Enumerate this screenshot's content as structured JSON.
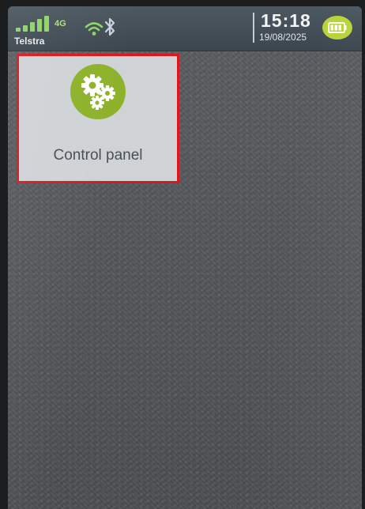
{
  "status_bar": {
    "network_type": "4G",
    "carrier": "Telstra",
    "signal_level": 5,
    "time": "15:18",
    "date": "19/08/2025",
    "battery_level": 1.0,
    "icons": {
      "signal": "cell-signal-icon",
      "wifi": "wifi-icon",
      "bluetooth": "bluetooth-icon",
      "battery": "battery-icon"
    }
  },
  "apps": [
    {
      "label": "Control panel",
      "icon": "gears-icon",
      "icon_color": "#8db22a",
      "selected": true
    }
  ],
  "colors": {
    "selection_border": "#e0161d",
    "signal": "#8fd36a",
    "battery_badge": "#b9d43a"
  }
}
